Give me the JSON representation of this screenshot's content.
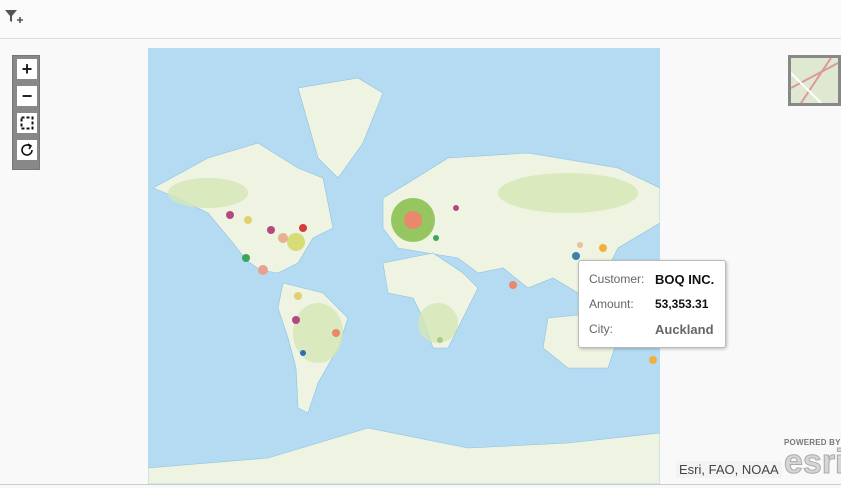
{
  "toolbar": {
    "filter_icon": "add-filter-icon"
  },
  "zoom_controls": {
    "zoom_in": "+",
    "zoom_out": "−",
    "icons": [
      "zoom-in-icon",
      "zoom-out-icon",
      "zoom-box-icon",
      "reset-icon"
    ]
  },
  "tooltip": {
    "customer_label": "Customer:",
    "customer": "BOQ INC.",
    "amount_label": "Amount:",
    "amount": "53,353.31",
    "city_label": "City:",
    "city": "Auckland"
  },
  "attribution": "Esri, FAO, NOAA",
  "logo": {
    "powered": "POWERED BY",
    "name": "esri"
  },
  "colors": {
    "ocean": "#b5dbf3",
    "land": "#eef3e2",
    "vegetation": "#d4e6b5"
  }
}
